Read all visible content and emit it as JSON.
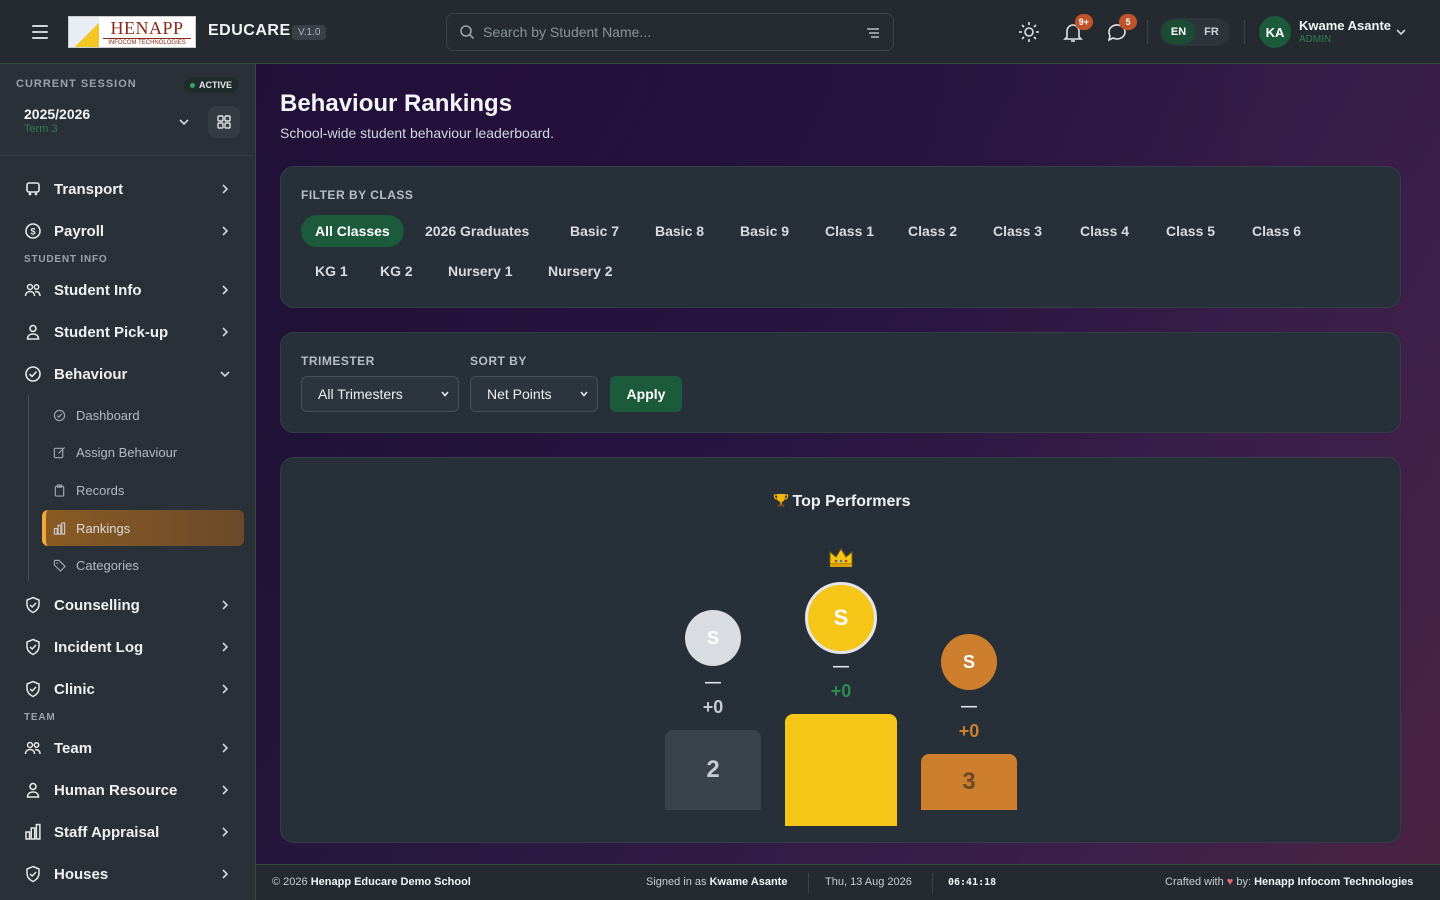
{
  "header": {
    "logo_text": "HENAPP",
    "logo_subtext": "INFOCOM TECHNOLOGIES",
    "brand": "EDUCARE",
    "version": "V.1.0",
    "search_placeholder": "Search by Student Name...",
    "notifications_badge": "9+",
    "messages_badge": "5",
    "languages": [
      "EN",
      "FR"
    ],
    "active_language": "EN",
    "user_initials": "KA",
    "user_name": "Kwame Asante",
    "user_role": "ADMIN"
  },
  "sidebar": {
    "session_label": "CURRENT SESSION",
    "session_status": "ACTIVE",
    "session_year": "2025/2026",
    "session_term": "Term 3",
    "items": [
      {
        "label": "Transport",
        "icon": "bus-icon"
      },
      {
        "label": "Payroll",
        "icon": "dollar-circle-icon"
      },
      {
        "section": "STUDENT INFO"
      },
      {
        "label": "Student Info",
        "icon": "users-icon"
      },
      {
        "label": "Student Pick-up",
        "icon": "user-icon"
      },
      {
        "label": "Behaviour",
        "icon": "check-circle-icon",
        "expanded": true
      },
      {
        "label": "Counselling",
        "icon": "shield-icon"
      },
      {
        "label": "Incident Log",
        "icon": "shield-icon"
      },
      {
        "label": "Clinic",
        "icon": "shield-icon"
      },
      {
        "section": "TEAM"
      },
      {
        "label": "Team",
        "icon": "users-icon"
      },
      {
        "label": "Human Resource",
        "icon": "user-icon"
      },
      {
        "label": "Staff Appraisal",
        "icon": "bar-chart-icon"
      },
      {
        "label": "Houses",
        "icon": "shield-icon"
      }
    ],
    "behaviour_sub": [
      {
        "label": "Dashboard",
        "icon": "check-circle-icon"
      },
      {
        "label": "Assign Behaviour",
        "icon": "edit-icon"
      },
      {
        "label": "Records",
        "icon": "clipboard-icon"
      },
      {
        "label": "Rankings",
        "icon": "bar-chart-icon",
        "active": true
      },
      {
        "label": "Categories",
        "icon": "tag-icon"
      }
    ]
  },
  "page": {
    "title": "Behaviour Rankings",
    "subtitle": "School-wide student behaviour leaderboard."
  },
  "filter": {
    "label": "FILTER BY CLASS",
    "classes": [
      "All Classes",
      "2026 Graduates",
      "Basic 7",
      "Basic 8",
      "Basic 9",
      "Class 1",
      "Class 2",
      "Class 3",
      "Class 4",
      "Class 5",
      "Class 6",
      "KG 1",
      "KG 2",
      "Nursery 1",
      "Nursery 2"
    ],
    "active": "All Classes"
  },
  "controls": {
    "trimester_label": "TRIMESTER",
    "trimester_value": "All Trimesters",
    "sort_label": "SORT BY",
    "sort_value": "Net Points",
    "apply_label": "Apply"
  },
  "podium": {
    "title": "Top Performers",
    "places": [
      {
        "rank": "2",
        "initial": "S",
        "name": "—",
        "points": "+0"
      },
      {
        "rank": "1",
        "initial": "S",
        "name": "—",
        "points": "+0"
      },
      {
        "rank": "3",
        "initial": "S",
        "name": "—",
        "points": "+0"
      }
    ],
    "colors": {
      "gold": "#f5c518",
      "silver": "#d9dce0",
      "bronze": "#cd7f2e",
      "green": "#2e8b4f"
    }
  },
  "footer": {
    "copyright": "© 2026",
    "school": "Henapp Educare Demo School",
    "signed_in_as": "Signed in as",
    "signed_user": "Kwame Asante",
    "date": "Thu, 13 Aug 2026",
    "time": "06:41:18",
    "crafted": "Crafted with",
    "by": "by:",
    "company": "Henapp Infocom Technologies"
  }
}
